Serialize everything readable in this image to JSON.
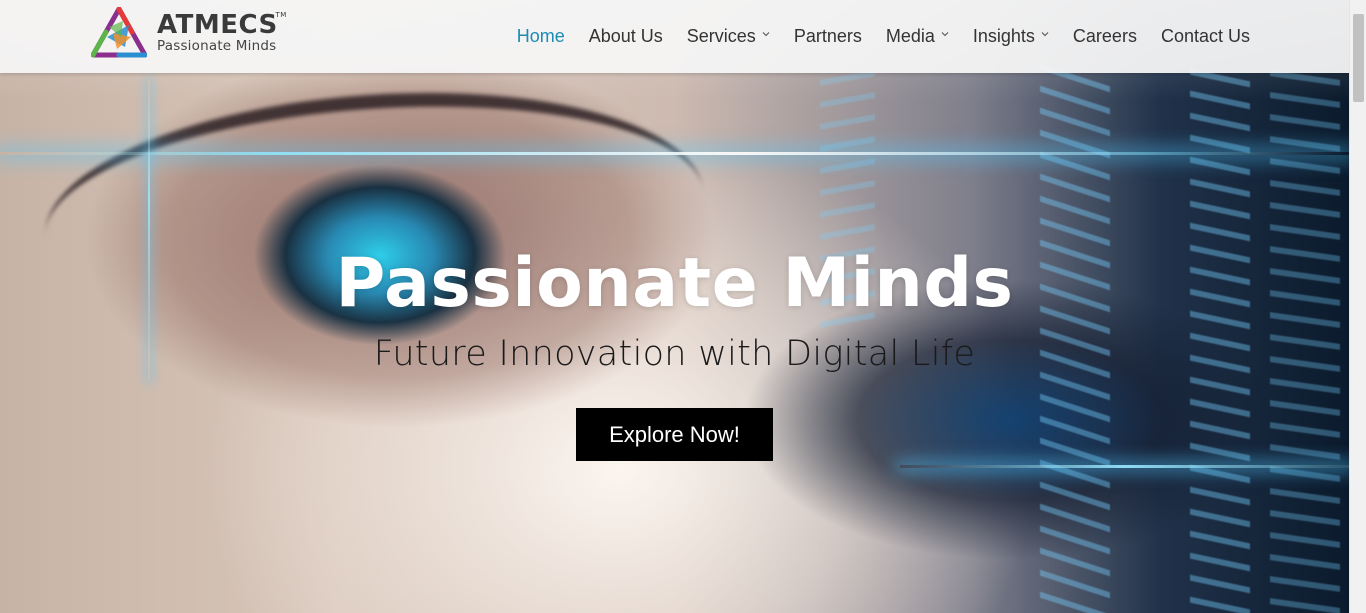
{
  "brand": {
    "name": "ATMECS",
    "trademark": "TM",
    "tagline": "Passionate Minds",
    "colors": {
      "purple": "#8b2f8f",
      "red": "#e43a3a",
      "green": "#5db54a",
      "blue": "#2a8fd0",
      "orange": "#f0912c"
    }
  },
  "nav": {
    "items": [
      {
        "label": "Home",
        "active": true,
        "has_dropdown": false
      },
      {
        "label": "About Us",
        "active": false,
        "has_dropdown": false
      },
      {
        "label": "Services",
        "active": false,
        "has_dropdown": true
      },
      {
        "label": "Partners",
        "active": false,
        "has_dropdown": false
      },
      {
        "label": "Media",
        "active": false,
        "has_dropdown": true
      },
      {
        "label": "Insights",
        "active": false,
        "has_dropdown": true
      },
      {
        "label": "Careers",
        "active": false,
        "has_dropdown": false
      },
      {
        "label": "Contact Us",
        "active": false,
        "has_dropdown": false
      }
    ],
    "active_color": "#1a8bb3",
    "text_color": "#333333"
  },
  "hero": {
    "title": "Passionate Minds",
    "subtitle": "Future Innovation with Digital Life",
    "cta_label": "Explore Now!"
  }
}
